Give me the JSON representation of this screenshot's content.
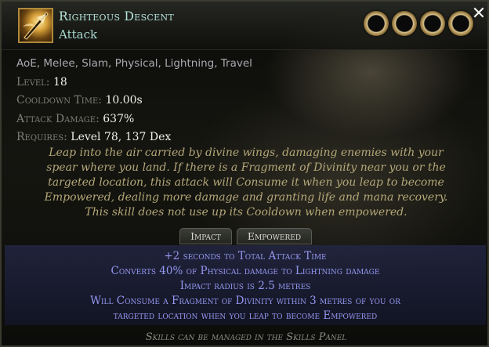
{
  "skill": {
    "name": "Righteous Descent",
    "type": "Attack"
  },
  "properties": {
    "tags": "AoE, Melee, Slam, Physical, Lightning, Travel",
    "level_label": "Level:",
    "level_value": "18",
    "cooldown_label": "Cooldown Time:",
    "cooldown_value": "10.00s",
    "attack_damage_label": "Attack Damage:",
    "attack_damage_value": "637%",
    "requires_label": "Requires:",
    "requires_value": "Level 78, 137 Dex"
  },
  "description": [
    "Leap into the air carried by divine wings, damaging enemies with your",
    "spear where you land. If there is a Fragment of Divinity near you or the",
    "targeted location, this attack will Consume it when you leap to become",
    "Empowered, dealing more damage and granting life and mana recovery.",
    "This skill does not use up its Cooldown when empowered."
  ],
  "tabs": [
    {
      "label": "Impact"
    },
    {
      "label": "Empowered"
    }
  ],
  "modifiers": [
    "+2 seconds to Total Attack Time",
    "Converts 40% of Physical damage to Lightning damage",
    "Impact radius is 2.5 metres",
    "Will Consume a Fragment of Divinity within 3 metres of you or",
    "targeted location when you leap to become Empowered"
  ],
  "footer": "Skills can be managed in the Skills Panel",
  "close_label": "✕",
  "sockets": [
    {
      "icon": "gem-socket"
    },
    {
      "icon": "gem-socket"
    },
    {
      "icon": "gem-socket"
    },
    {
      "icon": "gem-socket"
    }
  ],
  "colors": {
    "skill_name": "#b4e4da",
    "description": "#b3a778",
    "modifiers": "#9497f0",
    "socket_ring": "#d8c08a"
  }
}
